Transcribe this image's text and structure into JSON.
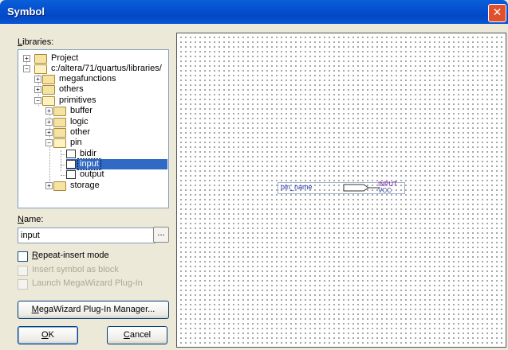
{
  "window": {
    "title": "Symbol",
    "close_glyph": "✕"
  },
  "libraries": {
    "label": "Libraries:",
    "label_underline": "L",
    "label_rest": "ibraries:",
    "tree": [
      {
        "label": "Project",
        "expander": "+",
        "icon": "folder-icon"
      },
      {
        "label": "c:/altera/71/quartus/libraries/",
        "expander": "−",
        "icon": "folder-open-icon"
      },
      {
        "label": "megafunctions",
        "expander": "+",
        "icon": "folder-icon"
      },
      {
        "label": "others",
        "expander": "+",
        "icon": "folder-icon"
      },
      {
        "label": "primitives",
        "expander": "−",
        "icon": "folder-open-icon"
      },
      {
        "label": "buffer",
        "expander": "+",
        "icon": "folder-icon"
      },
      {
        "label": "logic",
        "expander": "+",
        "icon": "folder-icon"
      },
      {
        "label": "other",
        "expander": "+",
        "icon": "folder-icon"
      },
      {
        "label": "pin",
        "expander": "−",
        "icon": "folder-open-icon"
      },
      {
        "label": "bidir",
        "icon": "pin-symbol-icon"
      },
      {
        "label": "input",
        "icon": "pin-symbol-icon",
        "selected": true
      },
      {
        "label": "output",
        "icon": "pin-symbol-icon"
      },
      {
        "label": "storage",
        "expander": "+",
        "icon": "folder-icon"
      }
    ]
  },
  "name": {
    "label_underline": "N",
    "label_rest": "ame:",
    "value": "input",
    "browse_label": "..."
  },
  "options": {
    "repeat_insert": {
      "underline": "R",
      "rest": "epeat-insert mode",
      "checked": false,
      "enabled": true
    },
    "insert_as_block": {
      "label": "Insert symbol as block",
      "checked": false,
      "enabled": false
    },
    "launch_megawizard": {
      "label": "Launch MegaWizard Plug-In",
      "checked": false,
      "enabled": false
    }
  },
  "buttons": {
    "megawizard_underline": "M",
    "megawizard_rest": "egaWizard Plug-In Manager...",
    "ok_underline": "O",
    "ok_rest": "K",
    "cancel_underline": "C",
    "cancel_rest": "ancel"
  },
  "preview": {
    "pin_name": "pin_name",
    "primitive": "INPUT",
    "default_value": "VCC"
  }
}
